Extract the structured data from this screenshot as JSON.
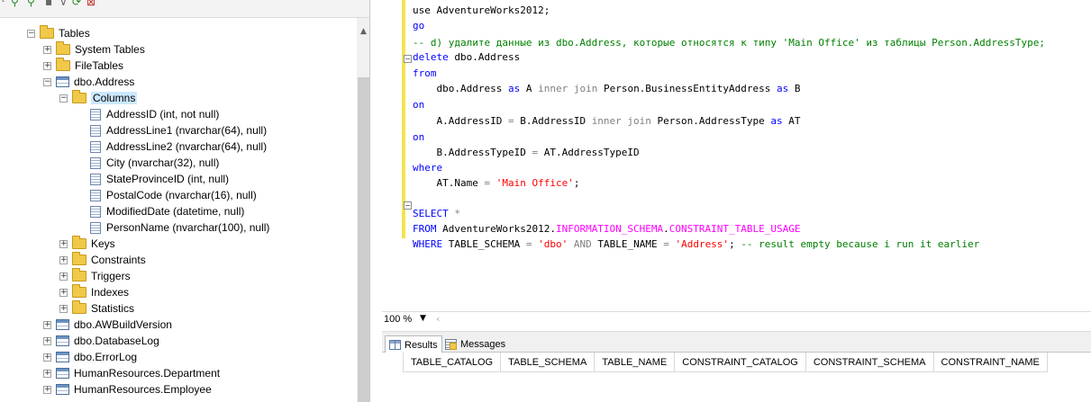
{
  "explorer": {
    "tree": [
      {
        "label": "Tables",
        "type": "folder",
        "expanded": true
      },
      {
        "label": "System Tables",
        "type": "folder",
        "expanded": false
      },
      {
        "label": "FileTables",
        "type": "folder",
        "expanded": false
      },
      {
        "label": "dbo.Address",
        "type": "table",
        "expanded": true
      },
      {
        "label": "Columns",
        "type": "folder",
        "expanded": true,
        "selected": true
      },
      {
        "label": "AddressID (int, not null)",
        "type": "column"
      },
      {
        "label": "AddressLine1 (nvarchar(64), null)",
        "type": "column"
      },
      {
        "label": "AddressLine2 (nvarchar(64), null)",
        "type": "column"
      },
      {
        "label": "City (nvarchar(32), null)",
        "type": "column"
      },
      {
        "label": "StateProvinceID (int, null)",
        "type": "column"
      },
      {
        "label": "PostalCode (nvarchar(16), null)",
        "type": "column"
      },
      {
        "label": "ModifiedDate (datetime, null)",
        "type": "column"
      },
      {
        "label": "PersonName (nvarchar(100), null)",
        "type": "column"
      },
      {
        "label": "Keys",
        "type": "folder",
        "expanded": false
      },
      {
        "label": "Constraints",
        "type": "folder",
        "expanded": false
      },
      {
        "label": "Triggers",
        "type": "folder",
        "expanded": false
      },
      {
        "label": "Indexes",
        "type": "folder",
        "expanded": false
      },
      {
        "label": "Statistics",
        "type": "folder",
        "expanded": false
      },
      {
        "label": "dbo.AWBuildVersion",
        "type": "table",
        "expanded": false
      },
      {
        "label": "dbo.DatabaseLog",
        "type": "table",
        "expanded": false
      },
      {
        "label": "dbo.ErrorLog",
        "type": "table",
        "expanded": false
      },
      {
        "label": "HumanResources.Department",
        "type": "table",
        "expanded": false
      },
      {
        "label": "HumanResources.Employee",
        "type": "table",
        "expanded": false
      }
    ]
  },
  "editor": {
    "lines": [
      [
        {
          "t": "use AdventureWorks2012;",
          "c": ""
        }
      ],
      [
        {
          "t": "go",
          "c": "kw"
        }
      ],
      [
        {
          "t": "-- d) удалите данные из dbo.Address, которые относятся к типу 'Main Office' из таблицы Person.AddressType;",
          "c": "cm"
        }
      ],
      [
        {
          "t": "delete",
          "c": "kw"
        },
        {
          "t": " dbo.Address",
          "c": ""
        }
      ],
      [
        {
          "t": "from",
          "c": "kw"
        }
      ],
      [
        {
          "t": "    dbo.Address ",
          "c": ""
        },
        {
          "t": "as",
          "c": "kw"
        },
        {
          "t": " A ",
          "c": ""
        },
        {
          "t": "inner join",
          "c": "gr"
        },
        {
          "t": " Person.BusinessEntityAddress ",
          "c": ""
        },
        {
          "t": "as",
          "c": "kw"
        },
        {
          "t": " B",
          "c": ""
        }
      ],
      [
        {
          "t": "on",
          "c": "kw"
        }
      ],
      [
        {
          "t": "    A.AddressID ",
          "c": ""
        },
        {
          "t": "=",
          "c": "gr"
        },
        {
          "t": " B.AddressID ",
          "c": ""
        },
        {
          "t": "inner join",
          "c": "gr"
        },
        {
          "t": " Person.AddressType ",
          "c": ""
        },
        {
          "t": "as",
          "c": "kw"
        },
        {
          "t": " AT",
          "c": ""
        }
      ],
      [
        {
          "t": "on",
          "c": "kw"
        }
      ],
      [
        {
          "t": "    B.AddressTypeID ",
          "c": ""
        },
        {
          "t": "=",
          "c": "gr"
        },
        {
          "t": " AT.AddressTypeID",
          "c": ""
        }
      ],
      [
        {
          "t": "where",
          "c": "kw"
        }
      ],
      [
        {
          "t": "    AT.Name ",
          "c": ""
        },
        {
          "t": "=",
          "c": "gr"
        },
        {
          "t": " ",
          "c": ""
        },
        {
          "t": "'Main Office'",
          "c": "str"
        },
        {
          "t": ";",
          "c": ""
        }
      ],
      [
        {
          "t": "",
          "c": ""
        }
      ],
      [
        {
          "t": "SELECT",
          "c": "kw"
        },
        {
          "t": " ",
          "c": ""
        },
        {
          "t": "*",
          "c": "gr"
        }
      ],
      [
        {
          "t": "FROM",
          "c": "kw"
        },
        {
          "t": " AdventureWorks2012.",
          "c": ""
        },
        {
          "t": "INFORMATION_SCHEMA",
          "c": "fn"
        },
        {
          "t": ".",
          "c": ""
        },
        {
          "t": "CONSTRAINT_TABLE_USAGE",
          "c": "fn"
        }
      ],
      [
        {
          "t": "WHERE",
          "c": "kw"
        },
        {
          "t": " TABLE_SCHEMA ",
          "c": ""
        },
        {
          "t": "=",
          "c": "gr"
        },
        {
          "t": " ",
          "c": ""
        },
        {
          "t": "'dbo'",
          "c": "str"
        },
        {
          "t": " ",
          "c": ""
        },
        {
          "t": "AND",
          "c": "gr"
        },
        {
          "t": " TABLE_NAME ",
          "c": ""
        },
        {
          "t": "=",
          "c": "gr"
        },
        {
          "t": " ",
          "c": ""
        },
        {
          "t": "'Address'",
          "c": "str"
        },
        {
          "t": "; ",
          "c": ""
        },
        {
          "t": "-- result empty because i run it earlier",
          "c": "cm"
        }
      ]
    ]
  },
  "zoom": {
    "level": "100 %"
  },
  "results": {
    "tabs": [
      {
        "label": "Results",
        "active": true
      },
      {
        "label": "Messages",
        "active": false
      }
    ],
    "columns": [
      "TABLE_CATALOG",
      "TABLE_SCHEMA",
      "TABLE_NAME",
      "CONSTRAINT_CATALOG",
      "CONSTRAINT_SCHEMA",
      "CONSTRAINT_NAME"
    ]
  }
}
